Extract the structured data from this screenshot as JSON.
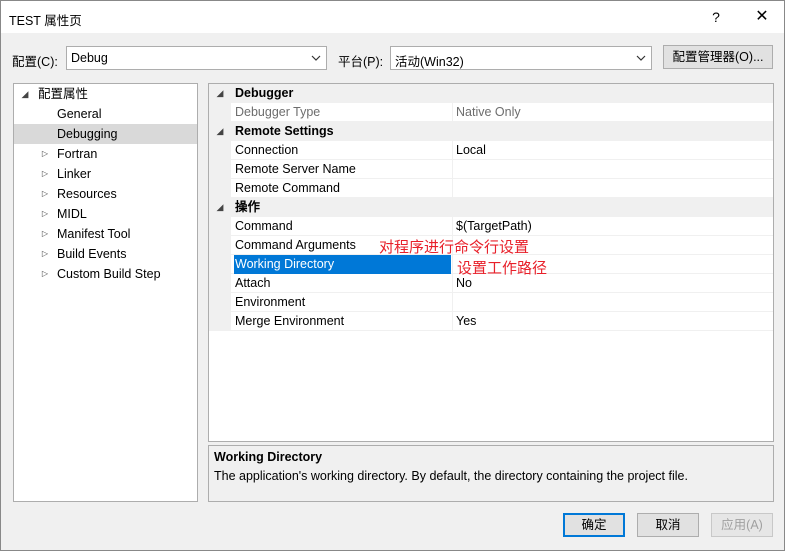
{
  "window": {
    "title": "TEST 属性页",
    "help_glyph": "?",
    "close_glyph": "✕"
  },
  "toolbar": {
    "config_label": "配置(C):",
    "config_value": "Debug",
    "platform_label": "平台(P):",
    "platform_value": "活动(Win32)",
    "config_manager_label": "配置管理器(O)..."
  },
  "tree": {
    "root": "配置属性",
    "items": [
      {
        "label": "General",
        "expandable": false,
        "selected": false
      },
      {
        "label": "Debugging",
        "expandable": false,
        "selected": true
      },
      {
        "label": "Fortran",
        "expandable": true,
        "selected": false
      },
      {
        "label": "Linker",
        "expandable": true,
        "selected": false
      },
      {
        "label": "Resources",
        "expandable": true,
        "selected": false
      },
      {
        "label": "MIDL",
        "expandable": true,
        "selected": false
      },
      {
        "label": "Manifest Tool",
        "expandable": true,
        "selected": false
      },
      {
        "label": "Build Events",
        "expandable": true,
        "selected": false
      },
      {
        "label": "Custom Build Step",
        "expandable": true,
        "selected": false
      }
    ]
  },
  "grid": {
    "rows": [
      {
        "type": "category",
        "key": "Debugger"
      },
      {
        "type": "prop",
        "key": "Debugger Type",
        "value": "Native Only",
        "disabled": true
      },
      {
        "type": "category",
        "key": "Remote Settings"
      },
      {
        "type": "prop",
        "key": "Connection",
        "value": "Local"
      },
      {
        "type": "prop",
        "key": "Remote Server Name",
        "value": ""
      },
      {
        "type": "prop",
        "key": "Remote Command",
        "value": ""
      },
      {
        "type": "category",
        "key": "操作"
      },
      {
        "type": "prop",
        "key": "Command",
        "value": "$(TargetPath)"
      },
      {
        "type": "prop",
        "key": "Command Arguments",
        "value": ""
      },
      {
        "type": "prop",
        "key": "Working Directory",
        "value": "",
        "selected": true
      },
      {
        "type": "prop",
        "key": "Attach",
        "value": "No"
      },
      {
        "type": "prop",
        "key": "Environment",
        "value": ""
      },
      {
        "type": "prop",
        "key": "Merge Environment",
        "value": "Yes"
      }
    ]
  },
  "description": {
    "title": "Working Directory",
    "text": "The application's working directory. By default, the directory containing the project file."
  },
  "annotations": {
    "command_args_note": "对程序进行命令行设置",
    "working_dir_note": "设置工作路径",
    "color": "#e8202a"
  },
  "footer": {
    "ok_label": "确定",
    "cancel_label": "取消",
    "apply_label": "应用(A)"
  },
  "colors": {
    "accent": "#0078d7",
    "selection_tree": "#d9d9d9"
  }
}
